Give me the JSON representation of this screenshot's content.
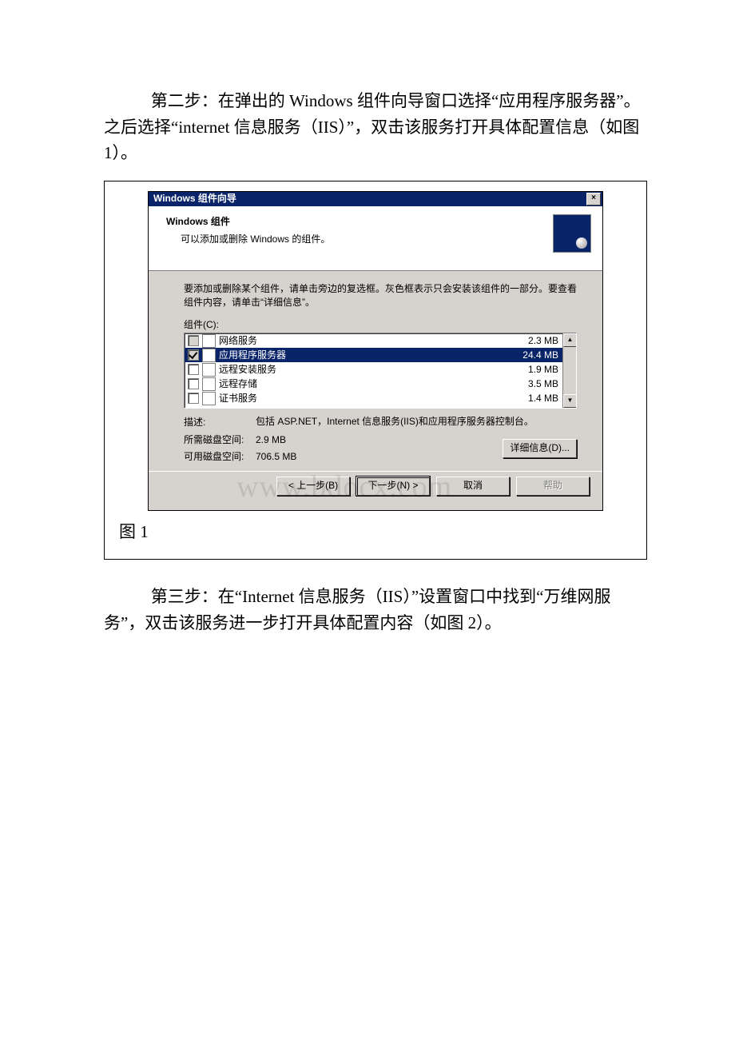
{
  "paragraphs": {
    "step2": "第二步：在弹出的 Windows 组件向导窗口选择“应用程序服务器”。之后选择“internet 信息服务（IIS）”，双击该服务打开具体配置信息（如图 1）。",
    "step3": "第三步：在“Internet 信息服务（IIS）”设置窗口中找到“万维网服务”，双击该服务进一步打开具体配置内容（如图 2）。"
  },
  "figure_caption": "图 1",
  "dialog": {
    "title": "Windows 组件向导",
    "close_x": "×",
    "banner_title": "Windows 组件",
    "banner_subtitle": "可以添加或删除 Windows 的组件。",
    "instructions": "要添加或删除某个组件，请单击旁边的复选框。灰色框表示只会安装该组件的一部分。要查看组件内容，请单击“详细信息”。",
    "list_label": "组件(C):",
    "items": [
      {
        "name": "网络服务",
        "size": "2.3 MB",
        "checked": false,
        "filled": true,
        "selected": false
      },
      {
        "name": "应用程序服务器",
        "size": "24.4 MB",
        "checked": true,
        "filled": true,
        "selected": true
      },
      {
        "name": "远程安装服务",
        "size": "1.9 MB",
        "checked": false,
        "filled": false,
        "selected": false
      },
      {
        "name": "远程存储",
        "size": "3.5 MB",
        "checked": false,
        "filled": false,
        "selected": false
      },
      {
        "name": "证书服务",
        "size": "1.4 MB",
        "checked": false,
        "filled": false,
        "selected": false
      }
    ],
    "desc_label": "描述:",
    "desc_text": "包括 ASP.NET，Internet 信息服务(IIS)和应用程序服务器控制台。",
    "required_label": "所需磁盘空间:",
    "required_value": "2.9 MB",
    "available_label": "可用磁盘空间:",
    "available_value": "706.5 MB",
    "details_btn": "详细信息(D)...",
    "back_btn": "< 上一步(B)",
    "next_btn": "下一步(N) >",
    "cancel_btn": "取消",
    "help_btn": "帮助",
    "scroll_up": "▲",
    "scroll_down": "▼",
    "watermark": "www.bdocx.com"
  }
}
